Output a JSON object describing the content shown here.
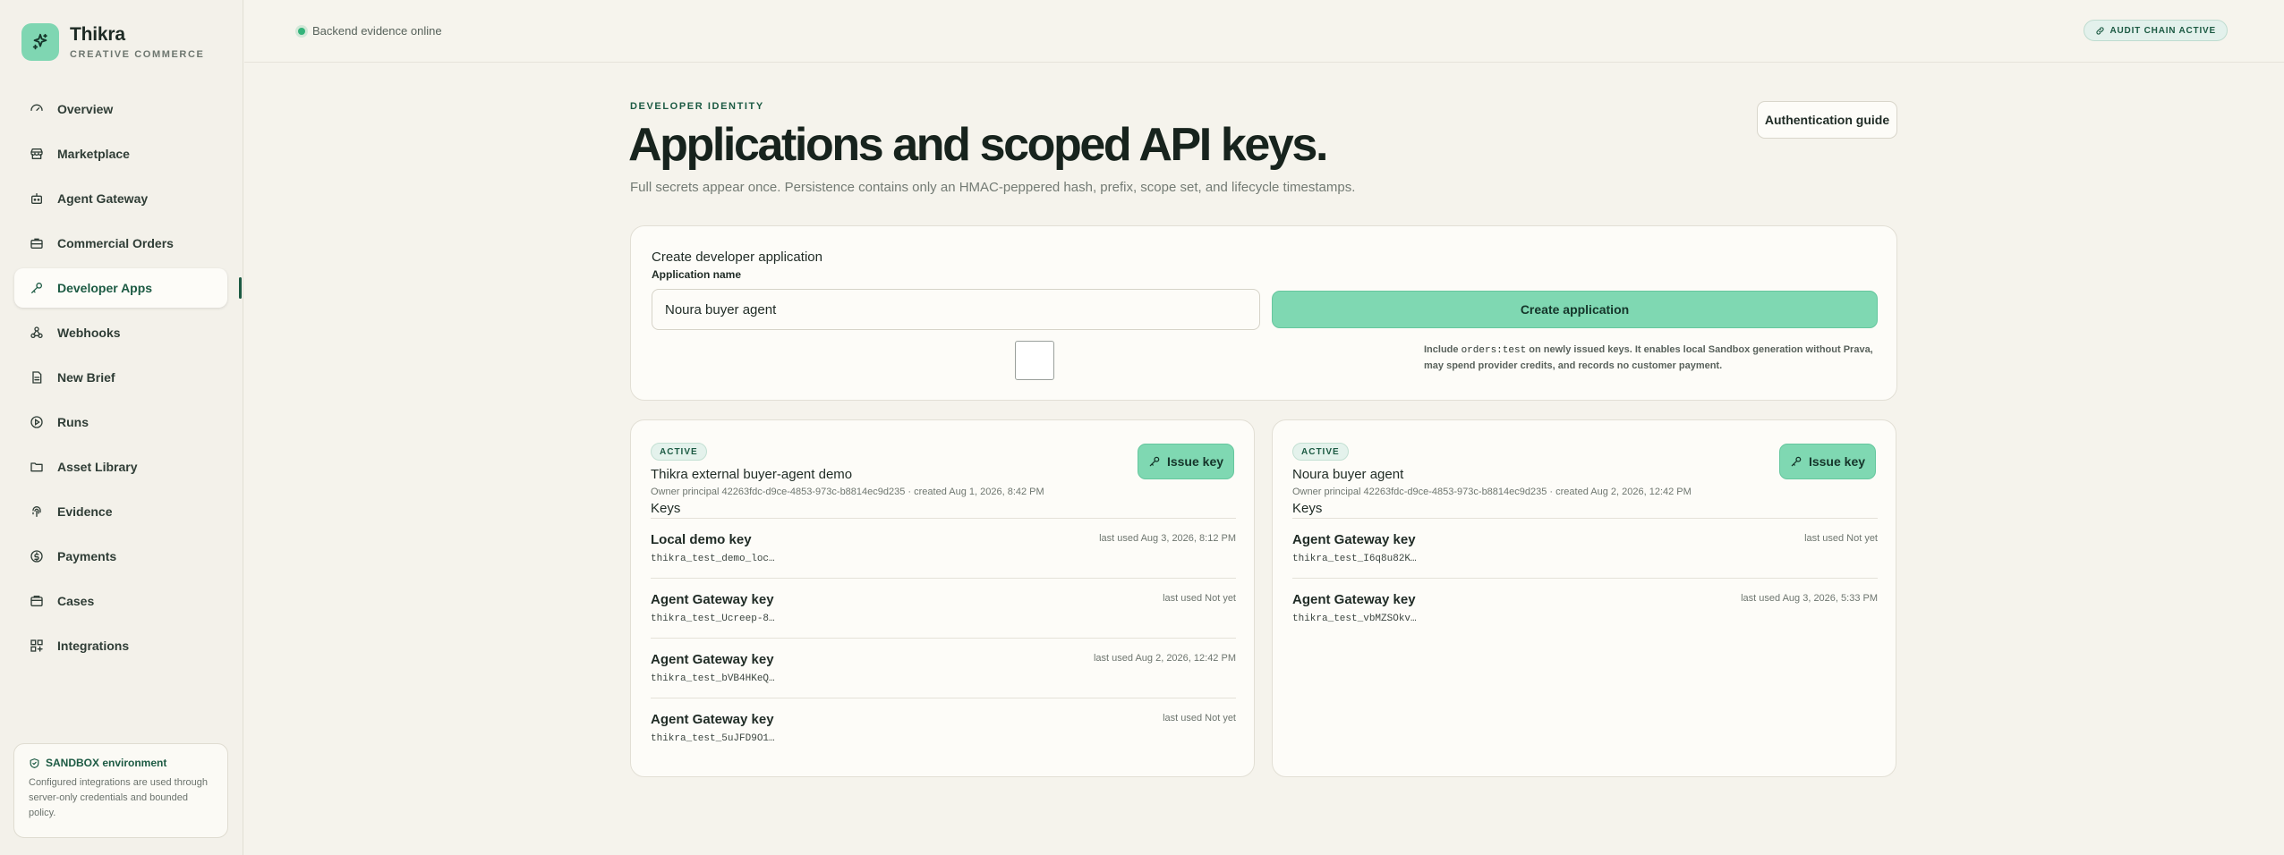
{
  "brand": {
    "name": "Thikra",
    "subtitle": "CREATIVE COMMERCE"
  },
  "sidebar": {
    "items": [
      {
        "label": "Overview",
        "icon": "gauge-icon"
      },
      {
        "label": "Marketplace",
        "icon": "store-icon"
      },
      {
        "label": "Agent Gateway",
        "icon": "bot-icon"
      },
      {
        "label": "Commercial Orders",
        "icon": "briefcase-icon"
      },
      {
        "label": "Developer Apps",
        "icon": "key-icon",
        "active": true
      },
      {
        "label": "Webhooks",
        "icon": "webhook-icon"
      },
      {
        "label": "New Brief",
        "icon": "document-icon"
      },
      {
        "label": "Runs",
        "icon": "play-icon"
      },
      {
        "label": "Asset Library",
        "icon": "folder-icon"
      },
      {
        "label": "Evidence",
        "icon": "fingerprint-icon"
      },
      {
        "label": "Payments",
        "icon": "coin-icon"
      },
      {
        "label": "Cases",
        "icon": "case-icon"
      },
      {
        "label": "Integrations",
        "icon": "grid-plus-icon"
      }
    ],
    "sandbox": {
      "title": "SANDBOX environment",
      "text": "Configured integrations are used through server-only credentials and bounded policy."
    }
  },
  "topbar": {
    "status": "Backend evidence online",
    "audit_badge": "AUDIT CHAIN ACTIVE"
  },
  "header": {
    "eyebrow": "DEVELOPER IDENTITY",
    "title": "Applications and scoped API keys.",
    "subtitle": "Full secrets appear once. Persistence contains only an HMAC-peppered hash, prefix, scope set, and lifecycle timestamps.",
    "auth_guide": "Authentication guide"
  },
  "create": {
    "title": "Create developer application",
    "field_label": "Application name",
    "field_value": "Noura buyer agent",
    "button": "Create application",
    "scope_note_prefix": "Include ",
    "scope_note_code": "orders:test",
    "scope_note_suffix": " on newly issued keys. It enables local Sandbox generation without Prava, may spend provider credits, and records no customer payment."
  },
  "apps": [
    {
      "status": "ACTIVE",
      "name": "Thikra external buyer-agent demo",
      "meta": "Owner principal 42263fdc-d9ce-4853-973c-b8814ec9d235 · created Aug 1, 2026, 8:42 PM",
      "keys_label": "Keys",
      "issue_label": "Issue key",
      "keys": [
        {
          "name": "Local demo key",
          "prefix": "thikra_test_demo_loc…",
          "used": "last used Aug 3, 2026, 8:12 PM"
        },
        {
          "name": "Agent Gateway key",
          "prefix": "thikra_test_Ucreep-8…",
          "used": "last used Not yet"
        },
        {
          "name": "Agent Gateway key",
          "prefix": "thikra_test_bVB4HKeQ…",
          "used": "last used Aug 2, 2026, 12:42 PM"
        },
        {
          "name": "Agent Gateway key",
          "prefix": "thikra_test_5uJFD9O1…",
          "used": "last used Not yet"
        }
      ]
    },
    {
      "status": "ACTIVE",
      "name": "Noura buyer agent",
      "meta": "Owner principal 42263fdc-d9ce-4853-973c-b8814ec9d235 · created Aug 2, 2026, 12:42 PM",
      "keys_label": "Keys",
      "issue_label": "Issue key",
      "keys": [
        {
          "name": "Agent Gateway key",
          "prefix": "thikra_test_I6q8u82K…",
          "used": "last used Not yet"
        },
        {
          "name": "Agent Gateway key",
          "prefix": "thikra_test_vbMZSOkv…",
          "used": "last used Aug 3, 2026, 5:33 PM"
        }
      ]
    }
  ],
  "colors": {
    "accent": "#7fd8b2",
    "accent_dark": "#1c5a43",
    "background": "#f5f3ec",
    "card": "#fdfcf8"
  }
}
